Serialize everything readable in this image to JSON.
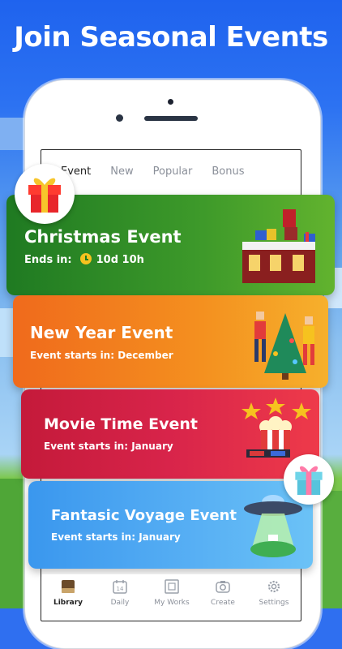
{
  "headline": "Join Seasonal Events",
  "tabs": [
    "Event",
    "New",
    "Popular",
    "Bonus"
  ],
  "active_tab": "Event",
  "cards": [
    {
      "title": "Christmas Event",
      "prefix": "Ends in:",
      "countdown": "10d 10h",
      "color": "#3e9a2a"
    },
    {
      "title": "New Year Event",
      "sub": "Event starts in: December",
      "color": "#f4901f"
    },
    {
      "title": "Movie Time Event",
      "sub": "Event starts in: January",
      "color": "#d8244a"
    },
    {
      "title": "Fantasic Voyage Event",
      "sub": "Event starts in: January",
      "color": "#58b0f4"
    }
  ],
  "nav": [
    {
      "label": "Library",
      "icon": "library-icon",
      "active": true
    },
    {
      "label": "Daily",
      "icon": "calendar-icon",
      "day": "14"
    },
    {
      "label": "My Works",
      "icon": "frame-icon"
    },
    {
      "label": "Create",
      "icon": "camera-icon"
    },
    {
      "label": "Settings",
      "icon": "gear-icon"
    }
  ]
}
